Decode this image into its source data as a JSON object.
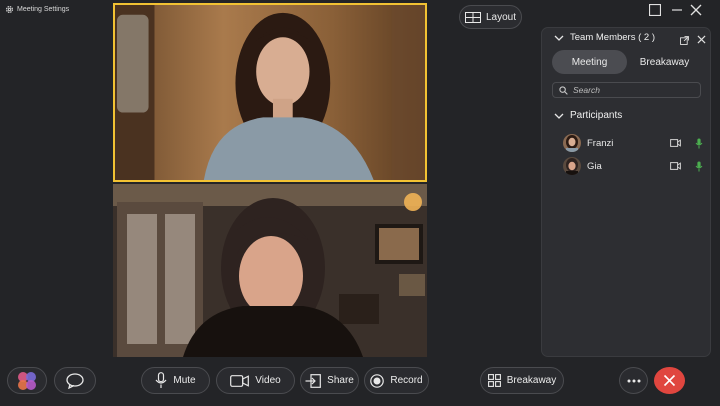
{
  "topbar": {
    "settings_label": "Meeting Settings",
    "layout_label": "Layout"
  },
  "panel": {
    "title": "Team Members ( 2 )",
    "tabs": [
      {
        "label": "Meeting",
        "active": true
      },
      {
        "label": "Breakaway",
        "active": false
      }
    ],
    "search_placeholder": "Search",
    "section_label": "Participants",
    "participants": [
      {
        "name": "Franzi"
      },
      {
        "name": "Gia"
      }
    ]
  },
  "toolbar": {
    "mute_label": "Mute",
    "video_label": "Video",
    "share_label": "Share",
    "record_label": "Record",
    "breakaway_label": "Breakaway"
  },
  "colors": {
    "active_speaker_border": "#f2c233",
    "end_call": "#e0463f",
    "mic_active": "#4caf50"
  }
}
